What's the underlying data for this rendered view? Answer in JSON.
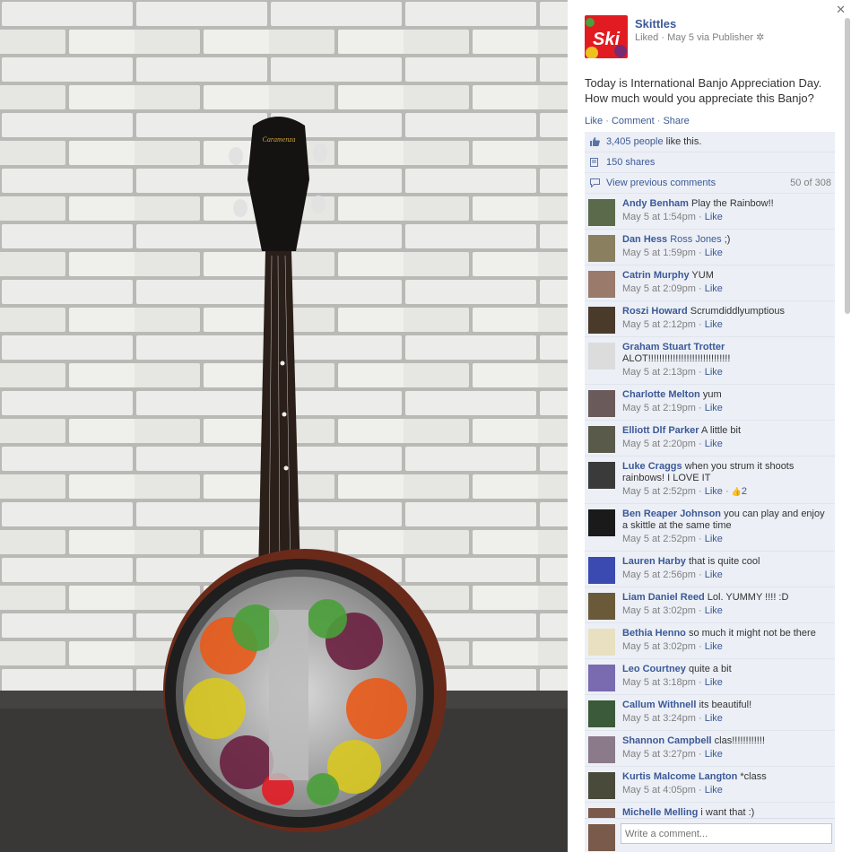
{
  "page": {
    "name": "Skittles",
    "meta": "Liked · May 5 via Publisher",
    "logo_text": "Ski"
  },
  "post": {
    "message_line1": "Today is International Banjo Appreciation Day.",
    "message_line2": "How much would you appreciate this Banjo?"
  },
  "actions": {
    "like": "Like",
    "comment": "Comment",
    "share": "Share"
  },
  "stats": {
    "likes_count": "3,405 people",
    "likes_suffix": " like this.",
    "shares": "150 shares",
    "view_previous": "View previous comments",
    "count": "50 of 308"
  },
  "comments": [
    {
      "name": "Andy Benham",
      "text": " Play the Rainbow!!",
      "time": "May 5 at 1:54pm",
      "like": "Like",
      "av": "#5a6a4a"
    },
    {
      "name": "Dan Hess",
      "text": "",
      "mention": "Ross Jones",
      "after": " ;)",
      "time": "May 5 at 1:59pm",
      "like": "Like",
      "av": "#8a8060"
    },
    {
      "name": "Catrin Murphy",
      "text": " YUM",
      "time": "May 5 at 2:09pm",
      "like": "Like",
      "av": "#9a7a6a"
    },
    {
      "name": "Roszi Howard",
      "text": " Scrumdiddlyumptious",
      "time": "May 5 at 2:12pm",
      "like": "Like",
      "av": "#4a3a2a"
    },
    {
      "name": "Graham Stuart Trotter",
      "text": " ALOT!!!!!!!!!!!!!!!!!!!!!!!!!!!!!!",
      "time": "May 5 at 2:13pm",
      "like": "Like",
      "av": "#dcdcdc"
    },
    {
      "name": "Charlotte Melton",
      "text": " yum",
      "time": "May 5 at 2:19pm",
      "like": "Like",
      "av": "#6a5a5a"
    },
    {
      "name": "Elliott Dlf Parker",
      "text": " A little bit",
      "time": "May 5 at 2:20pm",
      "like": "Like",
      "av": "#5a5a4a"
    },
    {
      "name": "Luke Craggs",
      "text": " when you strum it shoots rainbows! I LOVE IT",
      "time": "May 5 at 2:52pm",
      "like": "Like",
      "likes": "2",
      "av": "#3a3a3a"
    },
    {
      "name": "Ben Reaper Johnson",
      "text": " you can play and enjoy a skittle at the same time",
      "time": "May 5 at 2:52pm",
      "like": "Like",
      "av": "#1a1a1a"
    },
    {
      "name": "Lauren Harby",
      "text": " that is quite cool",
      "time": "May 5 at 2:56pm",
      "like": "Like",
      "av": "#3a4ab0"
    },
    {
      "name": "Liam Daniel Reed",
      "text": " Lol. YUMMY !!!! :D",
      "time": "May 5 at 3:02pm",
      "like": "Like",
      "av": "#6a5a3a"
    },
    {
      "name": "Bethia Henno",
      "text": " so much it might not be there",
      "time": "May 5 at 3:02pm",
      "like": "Like",
      "av": "#e8e0c0"
    },
    {
      "name": "Leo Courtney",
      "text": " quite a bit",
      "time": "May 5 at 3:18pm",
      "like": "Like",
      "av": "#7a6ab0"
    },
    {
      "name": "Callum Withnell",
      "text": " its beautiful!",
      "time": "May 5 at 3:24pm",
      "like": "Like",
      "av": "#3a5a3a"
    },
    {
      "name": "Shannon Campbell",
      "text": " clas!!!!!!!!!!!!",
      "time": "May 5 at 3:27pm",
      "like": "Like",
      "av": "#8a7a8a"
    },
    {
      "name": "Kurtis Malcome Langton",
      "text": " *class",
      "time": "May 5 at 4:05pm",
      "like": "Like",
      "av": "#4a4a3a"
    },
    {
      "name": "Michelle Melling",
      "text": " i want that :)",
      "time": "",
      "like": "",
      "av": "#7a5a4a"
    }
  ],
  "composer": {
    "placeholder": "Write a comment..."
  },
  "colors": {
    "fb_blue": "#3b5998",
    "ufi_bg": "#eceff5",
    "skittles_red": "#e21b23"
  }
}
